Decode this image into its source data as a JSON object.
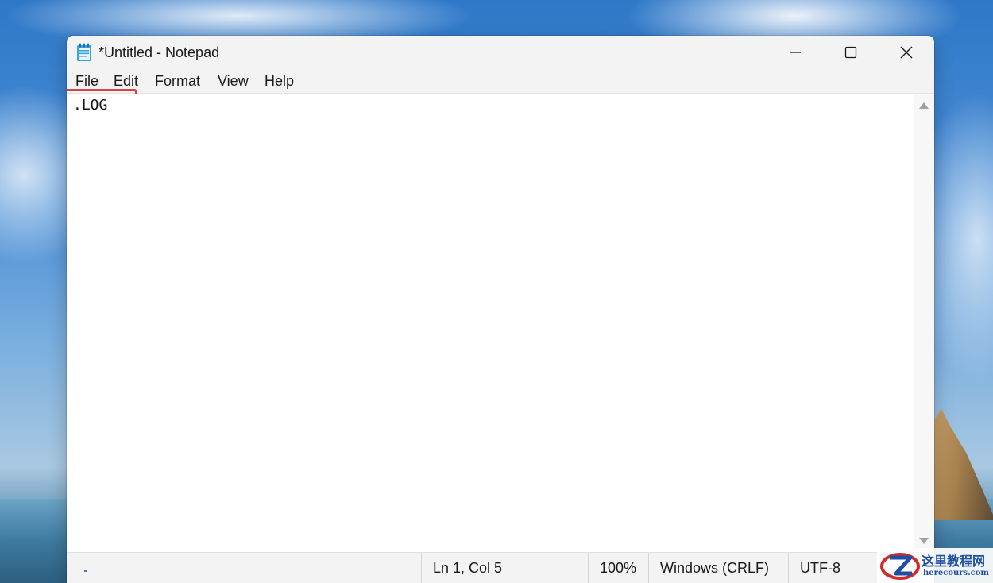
{
  "window": {
    "title": "*Untitled - Notepad",
    "app_icon": "notepad-icon"
  },
  "controls": {
    "minimize_icon": "minimize-icon",
    "maximize_icon": "maximize-icon",
    "close_icon": "close-icon"
  },
  "menu": {
    "items": [
      "File",
      "Edit",
      "Format",
      "View",
      "Help"
    ]
  },
  "editor": {
    "content": ".LOG"
  },
  "statusbar": {
    "position": "Ln 1, Col 5",
    "zoom": "100%",
    "line_ending": "Windows (CRLF)",
    "encoding": "UTF-8"
  },
  "watermark": {
    "title": "这里教程网",
    "subtitle": "herecours.com"
  },
  "colors": {
    "highlight": "#d64545",
    "titlebar": "#f3f3f3",
    "watermark": "#1f4fa0"
  }
}
